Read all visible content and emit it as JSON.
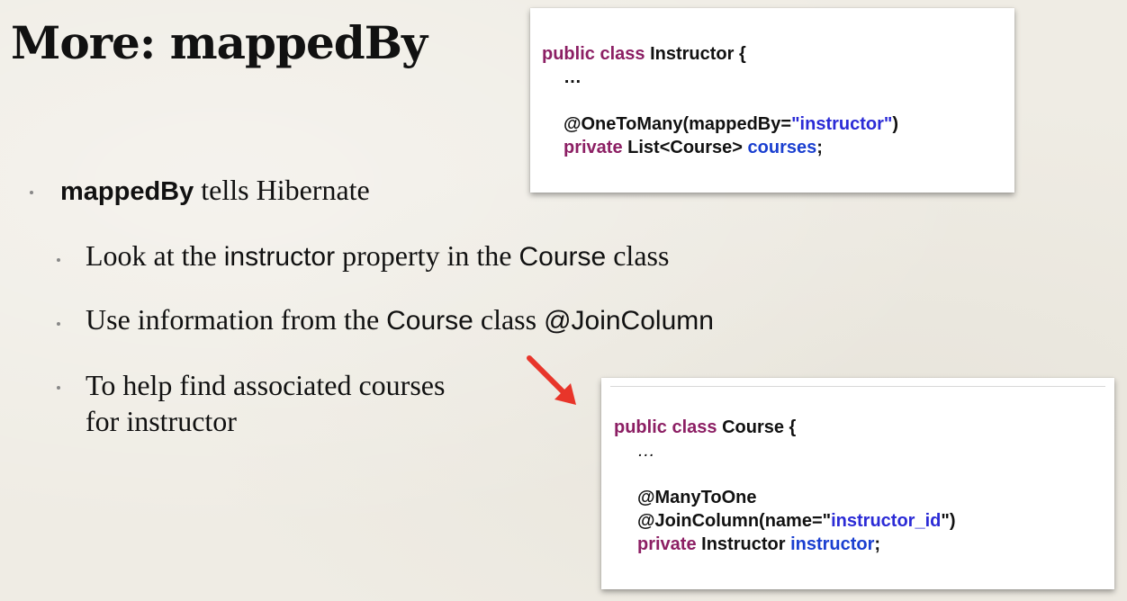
{
  "slide": {
    "title": "More: mappedBy"
  },
  "code_instructor": {
    "line1_kw": "public class ",
    "line1_name": "Instructor {",
    "line2": "…",
    "line3_pre": "@OneToMany(mappedBy=",
    "line3_str": "\"instructor\"",
    "line3_post": ")",
    "line4_kw": "private ",
    "line4_type": "List<Course> ",
    "line4_field": "courses",
    "line4_end": ";"
  },
  "code_course": {
    "line1_kw": "public class ",
    "line1_name": "Course {",
    "line2": "…",
    "line3": "@ManyToOne",
    "line4_pre": "@JoinColumn(name=\"",
    "line4_str": "instructor_id",
    "line4_post": "\")",
    "line5_kw": "private ",
    "line5_type": "Instructor ",
    "line5_field": "instructor",
    "line5_end": ";"
  },
  "bullets": {
    "b1_bold": "mappedBy",
    "b1_rest": " tells Hibernate",
    "b2_a": "Look at the ",
    "b2_b": "instructor",
    "b2_c": " property in the ",
    "b2_d": "Course",
    "b2_e": " class",
    "b3_a": "Use information from the ",
    "b3_b": "Course",
    "b3_c": " class ",
    "b3_d": "@JoinColumn",
    "b4_line1": "To help find associated courses",
    "b4_line2": "for instructor"
  },
  "colors": {
    "keyword": "#8c1f64",
    "string": "#2b2bd6",
    "field": "#1a3fd0",
    "arrow": "#e8352a"
  },
  "icons": {
    "arrow": "red-arrow-icon"
  }
}
